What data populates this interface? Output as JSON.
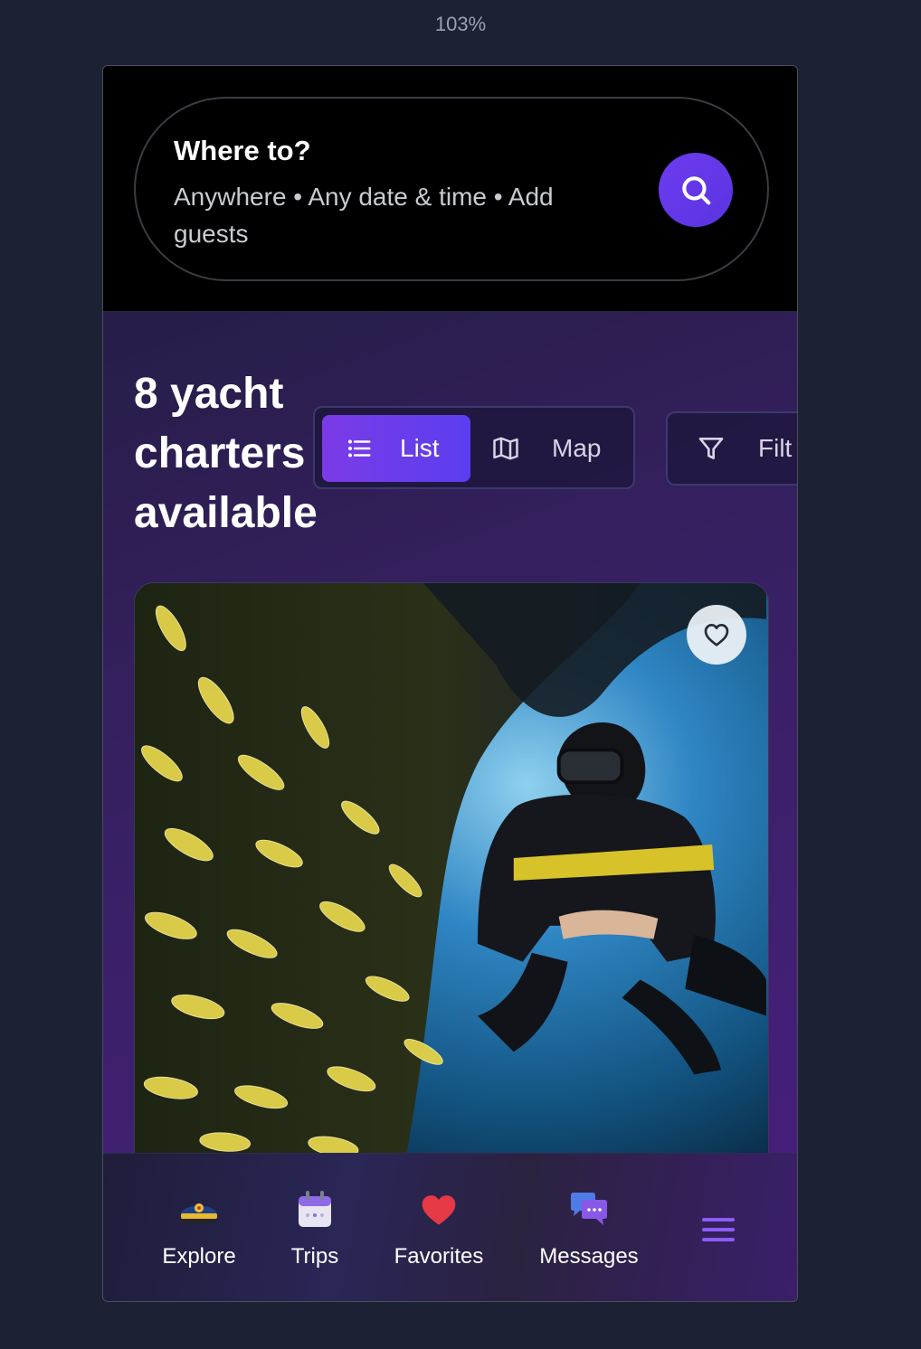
{
  "zoom_level": "103%",
  "search": {
    "title": "Where to?",
    "subtitle": "Anywhere • Any date & time • Add guests",
    "button_icon": "search-icon"
  },
  "results": {
    "heading": "8 yacht charters available"
  },
  "view_toggle": {
    "list_label": "List",
    "list_icon": "list-icon",
    "map_label": "Map",
    "map_icon": "map-icon",
    "active": "List"
  },
  "filter": {
    "label": "Filt",
    "icon": "filter-icon"
  },
  "listing_card": {
    "favorite_icon": "heart-outline-icon"
  },
  "bottom_nav": {
    "items": [
      {
        "label": "Explore",
        "icon": "captain-hat-icon"
      },
      {
        "label": "Trips",
        "icon": "calendar-icon"
      },
      {
        "label": "Favorites",
        "icon": "heart-icon"
      },
      {
        "label": "Messages",
        "icon": "chat-bubbles-icon"
      },
      {
        "label": "",
        "icon": "menu-icon"
      }
    ]
  },
  "colors": {
    "accent": "#6d3cf0",
    "toggle_active": "#7b3be6",
    "heart": "#e53945",
    "menu": "#8b5cf6"
  }
}
